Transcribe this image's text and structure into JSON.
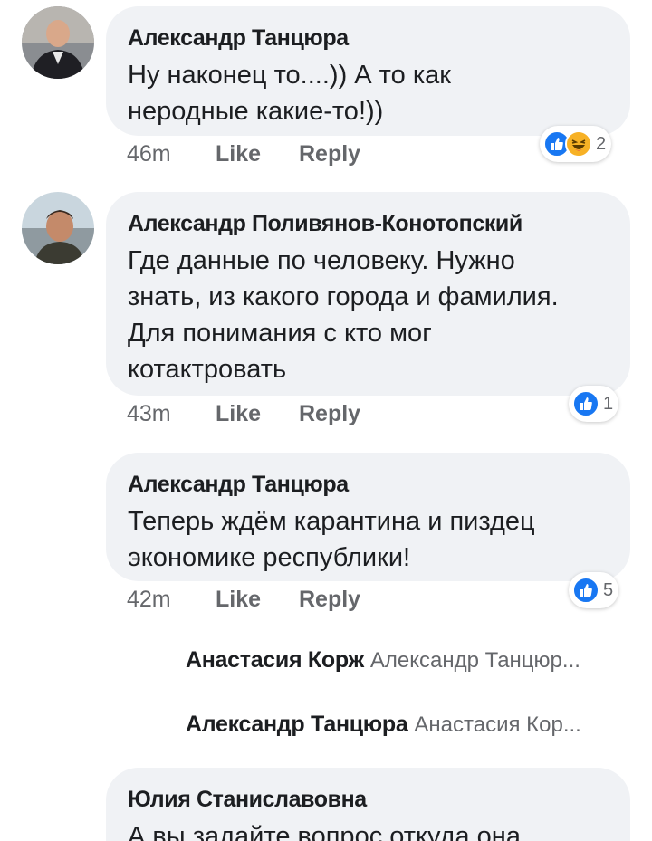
{
  "comments": [
    {
      "author": "Александр Танцюра",
      "lines": [
        "Ну наконец то....)) А то как",
        "неродные какие-то!))"
      ],
      "time": "46m",
      "like_label": "Like",
      "reply_label": "Reply",
      "reactions": [
        "like-icon",
        "haha-icon"
      ],
      "reaction_count": "2"
    },
    {
      "author": "Александр Поливянов-Конотопский",
      "lines": [
        "Где данные по человеку. Нужно",
        "знать, из какого города и фамилия.",
        "Для понимания с кто мог",
        "котактровать"
      ],
      "time": "43m",
      "like_label": "Like",
      "reply_label": "Reply",
      "reactions": [
        "like-icon"
      ],
      "reaction_count": "1"
    },
    {
      "author": "Александр Танцюра",
      "lines": [
        "Теперь ждём карантина и пиздец",
        "экономике республики!"
      ],
      "time": "42m",
      "like_label": "Like",
      "reply_label": "Reply",
      "reactions": [
        "like-icon"
      ],
      "reaction_count": "5"
    },
    {
      "author": "Юлия Станиславовна",
      "lines": [
        "А вы задайте вопрос откуда она"
      ]
    }
  ],
  "collapsed_replies": [
    {
      "author": "Анастасия Корж",
      "preview": "Александр Танцюр..."
    },
    {
      "author": "Александр Танцюра",
      "preview": "Анастасия Кор..."
    }
  ],
  "colors": {
    "bubble": "#f0f2f5",
    "like_blue": "#1877f2",
    "haha_yellow": "#f7b125",
    "meta_gray": "#65676b"
  }
}
